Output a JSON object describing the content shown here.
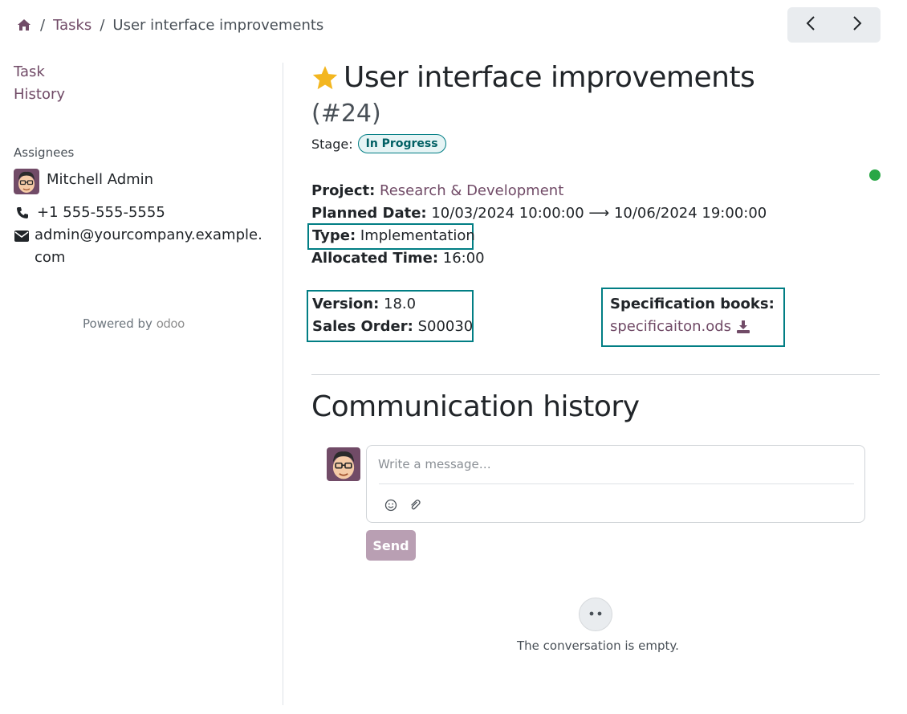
{
  "breadcrumb": {
    "home_icon": "home-icon",
    "items": [
      "Tasks",
      "User interface improvements"
    ],
    "separator": "/"
  },
  "pager": {
    "prev_icon": "chevron-left-icon",
    "next_icon": "chevron-right-icon"
  },
  "sidebar": {
    "links": [
      "Task",
      "History"
    ],
    "assignees_label": "Assignees",
    "assignee_name": "Mitchell Admin",
    "phone": "+1 555-555-5555",
    "email_line1": "admin@yourcompany.example.",
    "email_line2": "com",
    "powered_by": "Powered by",
    "brand": "odoo"
  },
  "task": {
    "title": "User interface improvements",
    "ref": "(#24)",
    "stage_label": "Stage:",
    "stage_value": "In Progress",
    "status_color": "#28a745",
    "project_label": "Project:",
    "project_value": "Research & Development",
    "planned_label": "Planned Date:",
    "planned_start": "10/03/2024 10:00:00",
    "planned_arrow": "⟶",
    "planned_end": "10/06/2024 19:00:00",
    "type_label": "Type:",
    "type_value": "Implementation",
    "allocated_label": "Allocated Time:",
    "allocated_value": "16:00",
    "version_label": "Version:",
    "version_value": "18.0",
    "sales_order_label": "Sales Order:",
    "sales_order_value": "S00030",
    "spec_label": "Specification books:",
    "spec_file": "specificaiton.ods"
  },
  "communication": {
    "title": "Communication history",
    "placeholder": "Write a message…",
    "send_label": "Send",
    "empty_text": "The conversation is empty."
  },
  "colors": {
    "accent": "#714b67",
    "highlight_border": "#017e84",
    "send_disabled": "#b99fb3"
  }
}
